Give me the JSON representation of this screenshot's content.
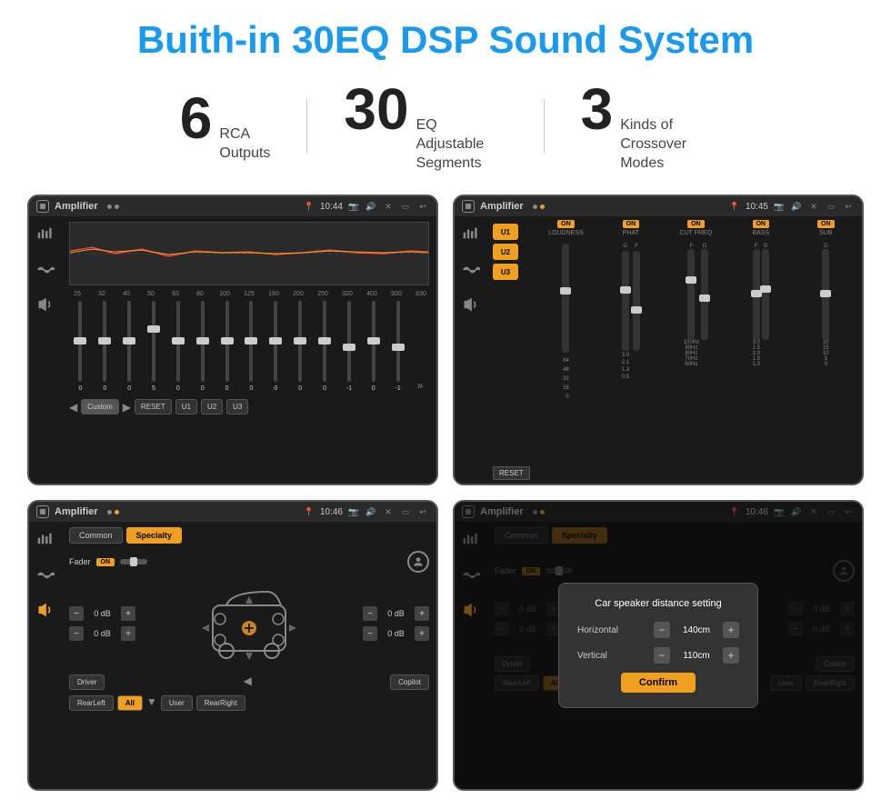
{
  "page": {
    "title": "Buith-in 30EQ DSP Sound System",
    "stats": [
      {
        "number": "6",
        "label": "RCA\nOutputs"
      },
      {
        "number": "30",
        "label": "EQ Adjustable\nSegments"
      },
      {
        "number": "3",
        "label": "Kinds of\nCrossover Modes"
      }
    ]
  },
  "screens": {
    "eq": {
      "app_name": "Amplifier",
      "time": "10:44",
      "eq_freqs": [
        "25",
        "32",
        "40",
        "50",
        "63",
        "80",
        "100",
        "125",
        "160",
        "200",
        "250",
        "320",
        "400",
        "500",
        "630"
      ],
      "eq_values": [
        "0",
        "0",
        "0",
        "5",
        "0",
        "0",
        "0",
        "0",
        "0",
        "0",
        "0",
        "-1",
        "0",
        "-1"
      ],
      "bottom_btns": [
        "Custom",
        "RESET",
        "U1",
        "U2",
        "U3"
      ]
    },
    "dsp": {
      "app_name": "Amplifier",
      "time": "10:45",
      "presets": [
        "U1",
        "U2",
        "U3"
      ],
      "channels": [
        {
          "on": true,
          "name": "LOUDNESS"
        },
        {
          "on": true,
          "name": "PHAT"
        },
        {
          "on": true,
          "name": "CUT FREQ"
        },
        {
          "on": true,
          "name": "BASS"
        },
        {
          "on": true,
          "name": "SUB"
        }
      ],
      "reset_label": "RESET"
    },
    "fader": {
      "app_name": "Amplifier",
      "time": "10:46",
      "tabs": [
        "Common",
        "Specialty"
      ],
      "fader_label": "Fader",
      "on_label": "ON",
      "vol_rows": [
        {
          "value": "0 dB"
        },
        {
          "value": "0 dB"
        },
        {
          "value": "0 dB"
        },
        {
          "value": "0 dB"
        }
      ],
      "bottom_btns": [
        "Driver",
        "RearLeft",
        "All",
        "User",
        "Copilot",
        "RearRight"
      ]
    },
    "fader_dialog": {
      "app_name": "Amplifier",
      "time": "10:46",
      "dialog_title": "Car speaker distance setting",
      "horizontal_label": "Horizontal",
      "horizontal_value": "140cm",
      "vertical_label": "Vertical",
      "vertical_value": "110cm",
      "confirm_label": "Confirm",
      "bottom_btns": [
        "Driver",
        "RearLeft",
        "All",
        "User",
        "Copilot",
        "RearRight"
      ]
    }
  }
}
